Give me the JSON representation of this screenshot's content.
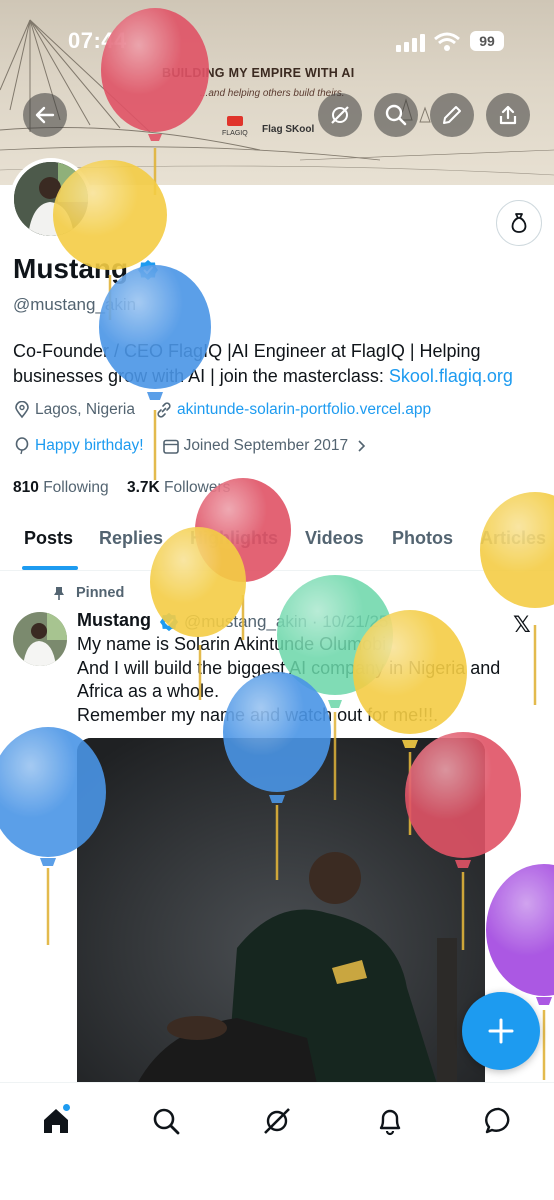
{
  "status_bar": {
    "time": "07:44",
    "battery": "99"
  },
  "banner": {
    "title": "BUILDING MY EMPIRE WITH AI",
    "subtitle": "...and helping others build theirs.",
    "logo_text": "FLAGIQ",
    "brand": "Flag SKool"
  },
  "profile": {
    "name": "Mustang",
    "handle": "@mustang_akin",
    "bio": "Co-Founder / CEO FlagIQ |AI Engineer at FlagIQ | Helping businesses grow with AI | join the masterclass: ",
    "bio_link": "Skool.flagiq.org",
    "location": "Lagos, Nigeria",
    "website": "akintunde-solarin-portfolio.vercel.app",
    "birthday": "Happy birthday!",
    "joined": "Joined September 2017",
    "following_count": "810",
    "following_label": "Following",
    "followers_count": "3.7K",
    "followers_label": "Followers"
  },
  "tabs": [
    "Posts",
    "Replies",
    "Highlights",
    "Videos",
    "Photos",
    "Articles"
  ],
  "post": {
    "pinned_label": "Pinned",
    "author": "Mustang",
    "meta": "@mustang_akin · 10/21/25",
    "text_lines": [
      "My name is Solarin Akintunde Olumobi",
      "And I will build the biggest AI company in Nigeria and",
      "Africa as a whole.",
      "Remember my name and watch out for me!!!."
    ],
    "source_icon": "x-logo-icon"
  },
  "colors": {
    "accent": "#1d9bf0",
    "text": "#0f1419",
    "secondary": "#536471",
    "balloon_red": "#e05366",
    "balloon_yellow": "#f4cd45",
    "balloon_blue": "#4a95e6",
    "balloon_green": "#6ad7a9",
    "balloon_purple": "#a247e0"
  }
}
